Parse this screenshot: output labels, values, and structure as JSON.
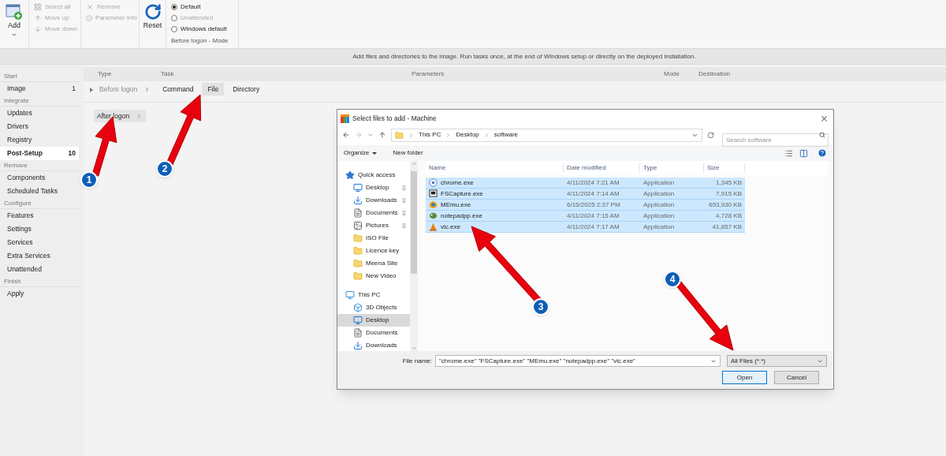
{
  "ribbon": {
    "add": {
      "label": "Add"
    },
    "list_actions": [
      {
        "label": "Select all",
        "kind": "select",
        "disabled": true
      },
      {
        "label": "Move up",
        "kind": "up",
        "disabled": true
      },
      {
        "label": "Move down",
        "kind": "down",
        "disabled": true
      }
    ],
    "item_actions": [
      {
        "label": "Remove",
        "kind": "remove",
        "disabled": true
      },
      {
        "label": "Parameter Info",
        "kind": "info",
        "disabled": true
      }
    ],
    "reset": {
      "label": "Reset"
    },
    "mode": {
      "options": [
        {
          "label": "Default",
          "selected": true,
          "disabled": false
        },
        {
          "label": "Unattended",
          "selected": false,
          "disabled": true
        },
        {
          "label": "Windows default",
          "selected": false,
          "disabled": false
        }
      ],
      "caption": "Before logon - Mode"
    }
  },
  "info_text": "Add files and directories to the image. Run tasks once, at the end of Windows setup or directly on the deployed installation.",
  "sidebar": {
    "groups": [
      {
        "heading": "Start",
        "items": [
          {
            "label": "Image",
            "count": "1",
            "selected": false
          }
        ]
      },
      {
        "heading": "Integrate",
        "items": [
          {
            "label": "Updates",
            "selected": false
          },
          {
            "label": "Drivers",
            "selected": false
          },
          {
            "label": "Registry",
            "selected": false
          },
          {
            "label": "Post-Setup",
            "count": "10",
            "selected": true
          }
        ]
      },
      {
        "heading": "Remove",
        "items": [
          {
            "label": "Components",
            "selected": false
          },
          {
            "label": "Scheduled Tasks",
            "selected": false
          }
        ]
      },
      {
        "heading": "Configure",
        "items": [
          {
            "label": "Features",
            "selected": false
          },
          {
            "label": "Settings",
            "selected": false
          },
          {
            "label": "Services",
            "selected": false
          },
          {
            "label": "Extra Services",
            "selected": false
          },
          {
            "label": "Unattended",
            "selected": false
          }
        ]
      },
      {
        "heading": "Finish",
        "items": [
          {
            "label": "Apply",
            "selected": false
          }
        ]
      }
    ]
  },
  "table": {
    "columns": [
      "Type",
      "Task",
      "Parameters",
      "Mode",
      "Destination"
    ],
    "types": [
      {
        "label": "Before logon",
        "selected": false,
        "tasks": [
          {
            "label": "Command",
            "selected": false
          },
          {
            "label": "File",
            "selected": true
          },
          {
            "label": "Directory",
            "selected": false
          }
        ]
      },
      {
        "label": "After logon",
        "selected": true
      }
    ]
  },
  "dialog": {
    "title": "Select files to add - Machine",
    "path": [
      "This PC",
      "Desktop",
      "software"
    ],
    "search_placeholder": "Search software",
    "toolbar": [
      "Organize",
      "New folder"
    ],
    "nav": [
      {
        "label": "Quick access",
        "kind": "star",
        "selected": false,
        "children": [
          {
            "label": "Desktop",
            "kind": "desktop",
            "pinned": true,
            "selected": false
          },
          {
            "label": "Downloads",
            "kind": "download",
            "pinned": true,
            "selected": false
          },
          {
            "label": "Documents",
            "kind": "document",
            "pinned": true,
            "selected": false
          },
          {
            "label": "Pictures",
            "kind": "picture",
            "pinned": true,
            "selected": false
          },
          {
            "label": "ISO File",
            "kind": "folder",
            "pinned": false,
            "selected": false
          },
          {
            "label": "Licence key",
            "kind": "folder",
            "pinned": false,
            "selected": false
          },
          {
            "label": "Meena Site",
            "kind": "folder",
            "pinned": false,
            "selected": false
          },
          {
            "label": "New Video",
            "kind": "folder",
            "pinned": false,
            "selected": false
          }
        ]
      },
      {
        "label": "This PC",
        "kind": "pc",
        "selected": false,
        "children": [
          {
            "label": "3D Objects",
            "kind": "objects",
            "pinned": false,
            "selected": false
          },
          {
            "label": "Desktop",
            "kind": "desktop",
            "pinned": false,
            "selected": true
          },
          {
            "label": "Documents",
            "kind": "document",
            "pinned": false,
            "selected": false
          },
          {
            "label": "Downloads",
            "kind": "download",
            "pinned": false,
            "selected": false
          }
        ]
      }
    ],
    "columns": [
      "Name",
      "Date modified",
      "Type",
      "Size"
    ],
    "files": [
      {
        "name": "chrome.exe",
        "kind": "chrome",
        "date": "4/11/2024 7:21 AM",
        "type": "Application",
        "size": "1,345 KB",
        "selected": true
      },
      {
        "name": "FSCapture.exe",
        "kind": "capture",
        "date": "4/11/2024 7:14 AM",
        "type": "Application",
        "size": "7,915 KB",
        "selected": true
      },
      {
        "name": "MEmu.exe",
        "kind": "memu",
        "date": "6/15/2025 2:37 PM",
        "type": "Application",
        "size": "653,930 KB",
        "selected": true
      },
      {
        "name": "notepadpp.exe",
        "kind": "notepad",
        "date": "4/11/2024 7:15 AM",
        "type": "Application",
        "size": "4,728 KB",
        "selected": true
      },
      {
        "name": "vlc.exe",
        "kind": "vlc",
        "date": "4/11/2024 7:17 AM",
        "type": "Application",
        "size": "41,857 KB",
        "selected": true
      }
    ],
    "filename_label": "File name:",
    "filename": "\"chrome.exe\" \"FSCapture.exe\" \"MEmu.exe\" \"notepadpp.exe\" \"vlc.exe\"",
    "filetype": "All Files (*.*)",
    "buttons": [
      {
        "label": "Open",
        "default": true
      },
      {
        "label": "Cancel",
        "default": false
      }
    ]
  },
  "annotations": [
    {
      "label": "1"
    },
    {
      "label": "2"
    },
    {
      "label": "3"
    },
    {
      "label": "4"
    }
  ]
}
